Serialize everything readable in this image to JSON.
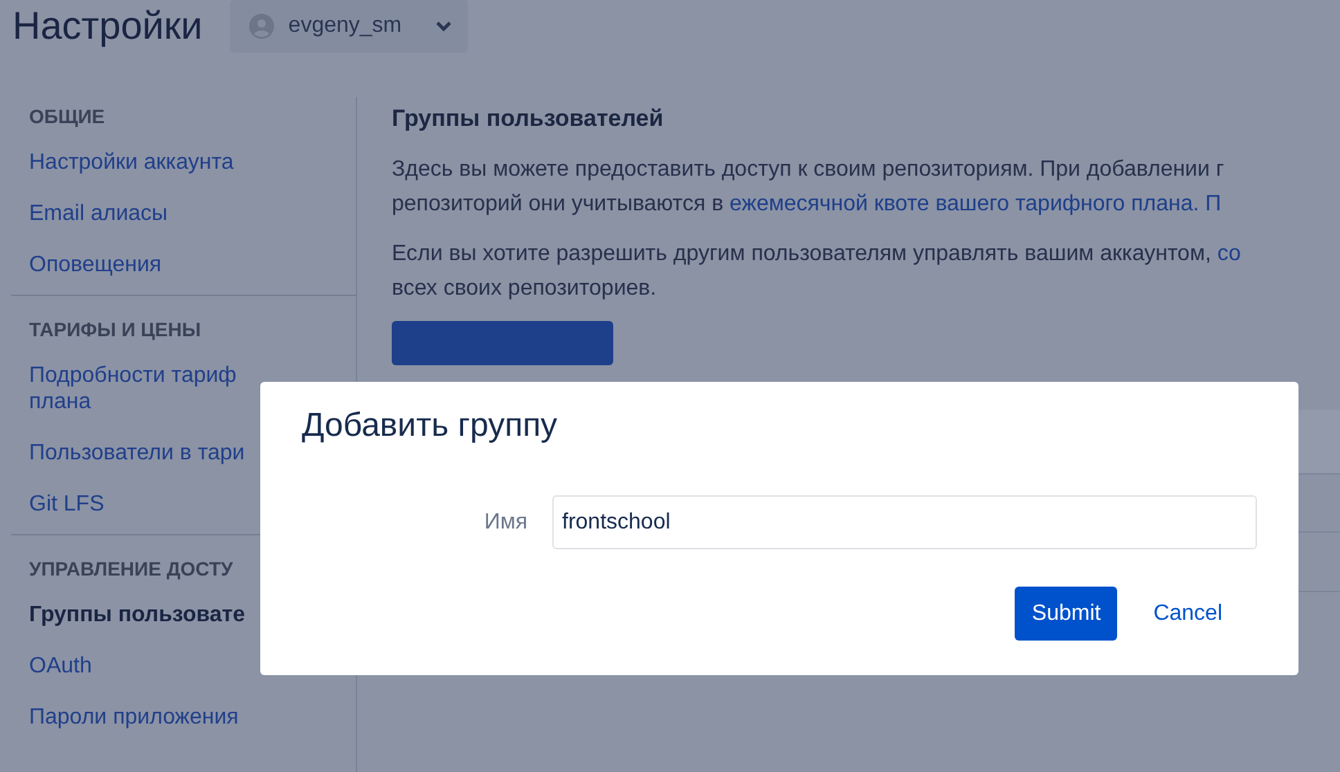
{
  "header": {
    "title": "Настройки",
    "account": {
      "name": "evgeny_sm"
    }
  },
  "sidebar": {
    "sections": [
      {
        "heading": "ОБЩИЕ",
        "items": [
          {
            "lines": [
              "Настройки аккаунта"
            ],
            "selected": false
          },
          {
            "lines": [
              "Email алиасы"
            ],
            "selected": false
          },
          {
            "lines": [
              "Оповещения"
            ],
            "selected": false
          }
        ]
      },
      {
        "heading": "ТАРИФЫ И ЦЕНЫ",
        "items": [
          {
            "lines": [
              "Подробности тариф",
              "плана"
            ],
            "selected": false
          },
          {
            "lines": [
              "Пользователи в тари"
            ],
            "selected": false
          },
          {
            "lines": [
              "Git LFS"
            ],
            "selected": false
          }
        ]
      },
      {
        "heading": "УПРАВЛЕНИЕ ДОСТУ",
        "items": [
          {
            "lines": [
              "Группы пользовате"
            ],
            "selected": true
          },
          {
            "lines": [
              "OAuth"
            ],
            "selected": false
          },
          {
            "lines": [
              "Пароли приложения"
            ],
            "selected": false
          }
        ]
      }
    ]
  },
  "content": {
    "heading": "Группы пользователей",
    "paragraphs": [
      {
        "lines": [
          [
            {
              "text": "Здесь вы можете предоставить доступ к своим репозиториям. При добавлении г",
              "link": false
            }
          ],
          [
            {
              "text": "репозиторий они учитываются в ",
              "link": false
            },
            {
              "text": "ежемесячной квоте вашего тарифного плана.",
              "link": true
            },
            {
              "text": " П",
              "link": true
            }
          ]
        ]
      },
      {
        "lines": [
          [
            {
              "text": "Если вы хотите разрешить другим пользователям управлять вашим аккаунтом, ",
              "link": false
            },
            {
              "text": "со",
              "link": true
            }
          ],
          [
            {
              "text": "всех своих репозиториев.",
              "link": false
            }
          ]
        ]
      }
    ]
  },
  "dialog": {
    "title": "Добавить группу",
    "fields": [
      {
        "label": "Имя",
        "value": "frontschool"
      }
    ],
    "buttons": [
      {
        "label": "Submit",
        "kind": "primary"
      },
      {
        "label": "Cancel",
        "kind": "link"
      }
    ]
  }
}
